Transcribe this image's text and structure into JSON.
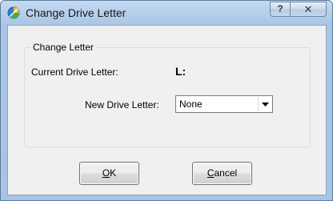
{
  "window": {
    "title": "Change Drive Letter",
    "help_glyph": "?",
    "close_glyph": "✕"
  },
  "group": {
    "legend": "Change Letter",
    "current_label": "Current Drive Letter:",
    "current_value": "L:",
    "new_label": "New Drive Letter:",
    "new_value": "None"
  },
  "buttons": {
    "ok_underlined": "O",
    "ok_rest": "K",
    "cancel_underlined": "C",
    "cancel_rest": "ancel"
  },
  "icons": {
    "app": "partition-tool-icon",
    "dropdown": "dropdown-arrow-icon"
  }
}
